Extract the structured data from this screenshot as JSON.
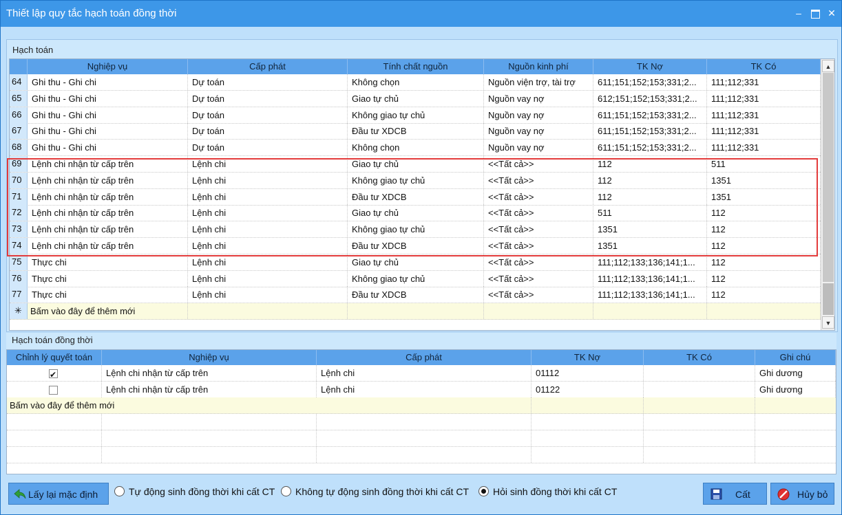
{
  "window": {
    "title": "Thiết lập quy tắc hạch toán đồng thời",
    "minimize": "–",
    "close": "✕"
  },
  "panel1": {
    "label": "Hạch toán",
    "columns": [
      "Nghiệp vụ",
      "Cấp phát",
      "Tính chất nguồn",
      "Nguồn kinh phí",
      "TK Nợ",
      "TK Có"
    ],
    "rows": [
      {
        "no": "64",
        "nghiep_vu": "Ghi thu - Ghi chi",
        "cap_phat": "Dự toán",
        "tinh_chat": "Không chọn",
        "nguon": "Nguồn viện trợ, tài trợ",
        "tk_no": "611;151;152;153;331;2...",
        "tk_co": "111;112;331"
      },
      {
        "no": "65",
        "nghiep_vu": "Ghi thu - Ghi chi",
        "cap_phat": "Dự toán",
        "tinh_chat": "Giao tự chủ",
        "nguon": "Nguồn vay nợ",
        "tk_no": "612;151;152;153;331;2...",
        "tk_co": "111;112;331"
      },
      {
        "no": "66",
        "nghiep_vu": "Ghi thu - Ghi chi",
        "cap_phat": "Dự toán",
        "tinh_chat": "Không giao tự chủ",
        "nguon": "Nguồn vay nợ",
        "tk_no": "611;151;152;153;331;2...",
        "tk_co": "111;112;331"
      },
      {
        "no": "67",
        "nghiep_vu": "Ghi thu - Ghi chi",
        "cap_phat": "Dự toán",
        "tinh_chat": "Đầu tư XDCB",
        "nguon": "Nguồn vay nợ",
        "tk_no": "611;151;152;153;331;2...",
        "tk_co": "111;112;331"
      },
      {
        "no": "68",
        "nghiep_vu": "Ghi thu - Ghi chi",
        "cap_phat": "Dự toán",
        "tinh_chat": "Không chọn",
        "nguon": "Nguồn vay nợ",
        "tk_no": "611;151;152;153;331;2...",
        "tk_co": "111;112;331"
      },
      {
        "no": "69",
        "nghiep_vu": "Lệnh chi nhận từ cấp trên",
        "cap_phat": "Lệnh chi",
        "tinh_chat": "Giao tự chủ",
        "nguon": "<<Tất cả>>",
        "tk_no": "112",
        "tk_co": "511"
      },
      {
        "no": "70",
        "nghiep_vu": "Lệnh chi nhận từ cấp trên",
        "cap_phat": "Lệnh chi",
        "tinh_chat": "Không giao tự chủ",
        "nguon": "<<Tất cả>>",
        "tk_no": "112",
        "tk_co": "1351"
      },
      {
        "no": "71",
        "nghiep_vu": "Lệnh chi nhận từ cấp trên",
        "cap_phat": "Lệnh chi",
        "tinh_chat": "Đầu tư XDCB",
        "nguon": "<<Tất cả>>",
        "tk_no": "112",
        "tk_co": "1351"
      },
      {
        "no": "72",
        "nghiep_vu": "Lệnh chi nhận từ cấp trên",
        "cap_phat": "Lệnh chi",
        "tinh_chat": "Giao tự chủ",
        "nguon": "<<Tất cả>>",
        "tk_no": "511",
        "tk_co": "112"
      },
      {
        "no": "73",
        "nghiep_vu": "Lệnh chi nhận từ cấp trên",
        "cap_phat": "Lệnh chi",
        "tinh_chat": "Không giao tự chủ",
        "nguon": "<<Tất cả>>",
        "tk_no": "1351",
        "tk_co": "112"
      },
      {
        "no": "74",
        "nghiep_vu": "Lệnh chi nhận từ cấp trên",
        "cap_phat": "Lệnh chi",
        "tinh_chat": "Đầu tư XDCB",
        "nguon": "<<Tất cả>>",
        "tk_no": "1351",
        "tk_co": "112"
      },
      {
        "no": "75",
        "nghiep_vu": "Thực chi",
        "cap_phat": "Lệnh chi",
        "tinh_chat": "Giao tự chủ",
        "nguon": "<<Tất cả>>",
        "tk_no": "111;112;133;136;141;1...",
        "tk_co": "112"
      },
      {
        "no": "76",
        "nghiep_vu": "Thực chi",
        "cap_phat": "Lệnh chi",
        "tinh_chat": "Không giao tự chủ",
        "nguon": "<<Tất cả>>",
        "tk_no": "111;112;133;136;141;1...",
        "tk_co": "112"
      },
      {
        "no": "77",
        "nghiep_vu": "Thực chi",
        "cap_phat": "Lệnh chi",
        "tinh_chat": "Đầu tư XDCB",
        "nguon": "<<Tất cả>>",
        "tk_no": "111;112;133;136;141;1...",
        "tk_co": "112"
      }
    ],
    "add_symbol": "✳",
    "add_label": "Bấm vào đây để thêm mới"
  },
  "panel2": {
    "label": "Hạch toán đồng thời",
    "columns": [
      "Chỉnh lý quyết toán",
      "Nghiệp vụ",
      "Cấp phát",
      "TK Nợ",
      "TK Có",
      "Ghi chú"
    ],
    "rows": [
      {
        "checked": true,
        "nghiep_vu": "Lệnh chi nhận từ cấp trên",
        "cap_phat": "Lệnh chi",
        "tk_no": "01112",
        "tk_co": "",
        "ghi_chu": "Ghi dương"
      },
      {
        "checked": false,
        "nghiep_vu": "Lệnh chi nhận từ cấp trên",
        "cap_phat": "Lệnh chi",
        "tk_no": "01122",
        "tk_co": "",
        "ghi_chu": "Ghi dương"
      }
    ],
    "add_label": "Bấm vào đây để thêm mới"
  },
  "footer": {
    "reset_label": "Lấy lại mặc định",
    "radio_options": [
      {
        "label": "Tự động sinh đồng thời khi cất CT",
        "selected": false
      },
      {
        "label": "Không tự động sinh đồng thời khi cất CT",
        "selected": false
      },
      {
        "label": "Hỏi sinh đồng thời khi cất CT",
        "selected": true
      }
    ],
    "save_label": "Cất",
    "cancel_label": "Hủy bỏ"
  },
  "colors": {
    "title_bar": "#3d97e8",
    "header": "#5ba2ea",
    "highlight_box": "#e33b3b",
    "add_row": "#fbfbdf"
  }
}
